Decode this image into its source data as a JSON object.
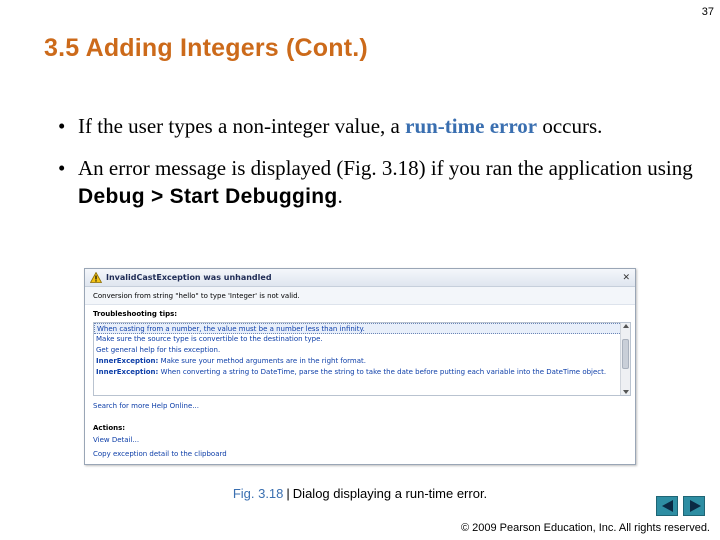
{
  "slide": {
    "number": "37",
    "title": "3.5 Adding Integers (Cont.)",
    "bullets": {
      "b1_pre": "If the user types a non-integer value, a ",
      "b1_term": "run-time error",
      "b1_post": " occurs.",
      "b2_pre": "An error message is displayed (Fig. 3.18) if you ran the application using ",
      "b2_code": "Debug > Start Debugging",
      "b2_post": "."
    },
    "bullet_glyph": "•"
  },
  "dialog": {
    "title": "InvalidCastException was unhandled",
    "message": "Conversion from string \"hello\" to type 'Integer' is not valid.",
    "tips_heading": "Troubleshooting tips:",
    "tips": [
      "When casting from a number, the value must be a number less than infinity.",
      "Make sure the source type is convertible to the destination type.",
      "Get general help for this exception.",
      "Make sure your method arguments are in the right format.",
      "When converting a string to DateTime, parse the string to take the date before putting each variable into the DateTime object."
    ],
    "inner_prefix": "InnerException:",
    "search_link": "Search for more Help Online...",
    "actions_heading": "Actions:",
    "actions": [
      "View Detail...",
      "Copy exception detail to the clipboard"
    ],
    "close_glyph": "✕"
  },
  "caption": {
    "fig": "Fig. 3.18",
    "sep": "|",
    "text": "Dialog displaying a run-time error."
  },
  "copyright": "© 2009 Pearson Education, Inc.  All rights reserved.",
  "colors": {
    "title": "#cc6a1a",
    "term": "#3a6fb0",
    "nav": "#2e8ea3"
  }
}
